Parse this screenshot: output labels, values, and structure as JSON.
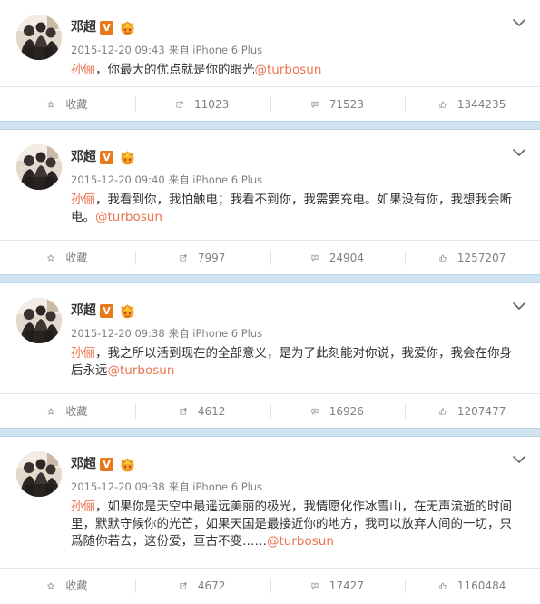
{
  "user": {
    "name": "邓超",
    "verified_badge": "V"
  },
  "colors": {
    "accent": "#eb7350",
    "verified": "#e8791a",
    "separator": "#cfe3f0",
    "meta": "#808080"
  },
  "actions": {
    "favorite_label": "收藏"
  },
  "posts": [
    {
      "timestamp": "2015-12-20 09:43",
      "source": "来自 iPhone 6 Plus",
      "mention_name": "孙俪",
      "text": "，你最大的优点就是你的眼光",
      "link": "@turbosun",
      "reposts": "11023",
      "comments": "71523",
      "likes": "1344235"
    },
    {
      "timestamp": "2015-12-20 09:40",
      "source": "来自 iPhone 6 Plus",
      "mention_name": "孙俪",
      "text": "，我看到你，我怕触电；我看不到你，我需要充电。如果没有你，我想我会断电。",
      "link": "@turbosun",
      "reposts": "7997",
      "comments": "24904",
      "likes": "1257207"
    },
    {
      "timestamp": "2015-12-20 09:38",
      "source": "来自 iPhone 6 Plus",
      "mention_name": "孙俪",
      "text": "，我之所以活到现在的全部意义，是为了此刻能对你说，我爱你，我会在你身后永远",
      "link": "@turbosun",
      "reposts": "4612",
      "comments": "16926",
      "likes": "1207477"
    },
    {
      "timestamp": "2015-12-20 09:38",
      "source": "来自 iPhone 6 Plus",
      "mention_name": "孙俪",
      "text": "，如果你是天空中最遥远美丽的极光，我情愿化作冰雪山，在无声流逝的时间里，默默守候你的光芒，如果天国是最接近你的地方，我可以放弃人间的一切，只爲随你若去，这份爱，亘古不变……",
      "link": "@turbosun",
      "reposts": "4672",
      "comments": "17427",
      "likes": "1160484"
    }
  ]
}
